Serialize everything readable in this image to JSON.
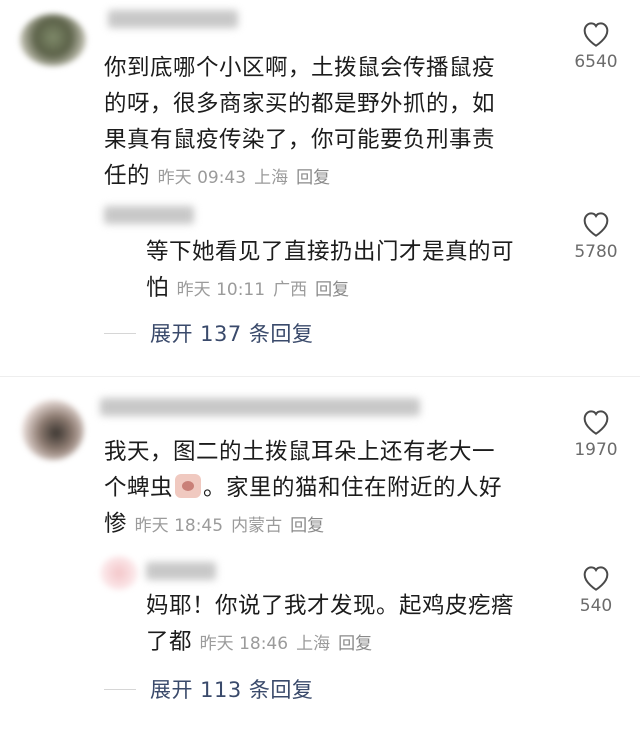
{
  "comments": [
    {
      "text": "你到底哪个小区啊，土拨鼠会传播鼠疫的呀，很多商家买的都是野外抓的，如果真有鼠疫传染了，你可能要负刑事责任的",
      "lines": [
        "你到底哪个小区啊，土拨鼠会传播鼠疫",
        "的呀，很多商家买的都是野外抓的，如",
        "果真有鼠疫传染了，你可能要负刑事责",
        "任的"
      ],
      "time": "昨天 09:43",
      "location": "上海",
      "reply_label": "回复",
      "likes": "6540",
      "reply": {
        "lines": [
          "等下她看见了直接扔出门才是真的可",
          "怕"
        ],
        "time": "昨天 10:11",
        "location": "广西",
        "reply_label": "回复",
        "likes": "5780"
      },
      "expand_label": "展开 137 条回复"
    },
    {
      "lines": [
        "我天，图二的土拨鼠耳朵上还有老大一",
        "个蜱虫",
        "。家里的猫和住在附近的人好",
        "惨"
      ],
      "time": "昨天 18:45",
      "location": "内蒙古",
      "reply_label": "回复",
      "likes": "1970",
      "reply": {
        "lines": [
          "妈耶！你说了我才发现。起鸡皮疙瘩",
          "了都"
        ],
        "time": "昨天 18:46",
        "location": "上海",
        "reply_label": "回复",
        "likes": "540"
      },
      "expand_label": "展开 113 条回复"
    }
  ],
  "colors": {
    "text": "#1c1c1c",
    "meta": "#9b9b9b",
    "expand": "#3a4a6b"
  }
}
